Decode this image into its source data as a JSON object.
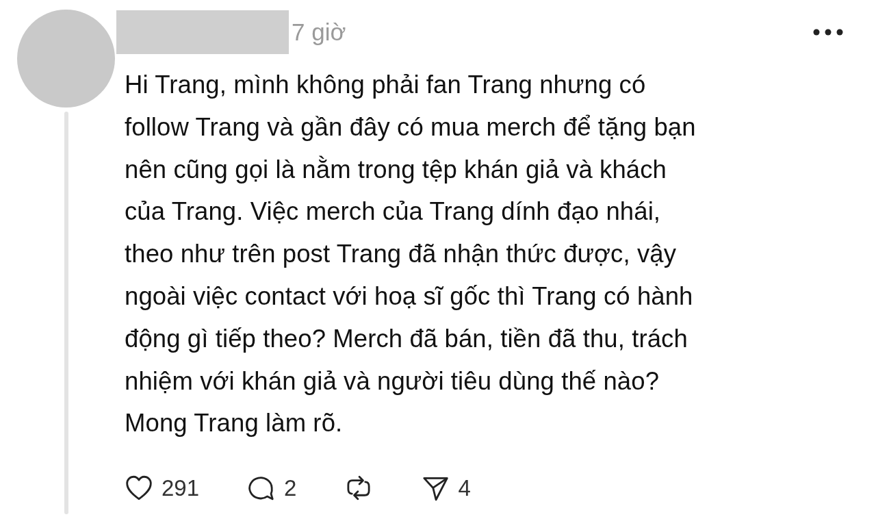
{
  "post": {
    "time": "7 giờ",
    "text": "Hi Trang, mình không phải fan Trang nhưng có\nfollow Trang và gần đây có mua merch để tặng bạn\nnên cũng gọi là nằm trong tệp khán giả và khách\ncủa Trang. Việc merch của Trang dính đạo nhái,\ntheo như trên post Trang đã nhận thức được, vậy\nngoài việc contact với hoạ sĩ gốc thì Trang có hành\nđộng gì tiếp theo? Merch đã bán, tiền đã thu, trách\nnhiệm với khán giả và người tiêu dùng thế nào?\nMong Trang làm rõ.",
    "actions": [
      {
        "kind": "like",
        "count": "291"
      },
      {
        "kind": "reply",
        "count": "2"
      },
      {
        "kind": "repost"
      },
      {
        "kind": "share",
        "count": "4"
      }
    ]
  }
}
